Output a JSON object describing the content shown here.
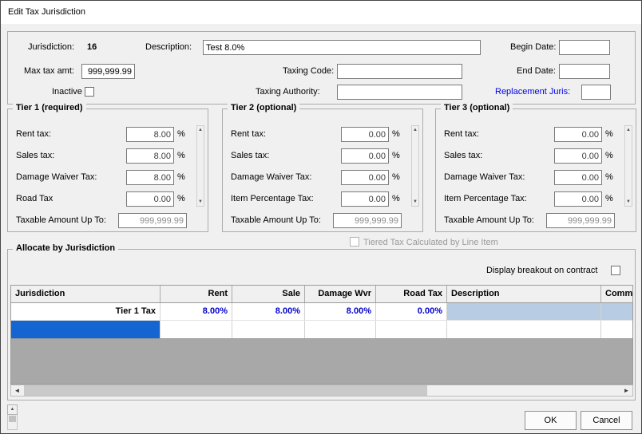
{
  "window": {
    "title": "Edit Tax Jurisdiction"
  },
  "header": {
    "jurisdiction_label": "Jurisdiction:",
    "jurisdiction_value": "16",
    "description_label": "Description:",
    "description_value": "Test 8.0%",
    "begin_date_label": "Begin Date:",
    "begin_date_value": "",
    "max_tax_label": "Max tax amt:",
    "max_tax_value": "999,999.99",
    "taxing_code_label": "Taxing Code:",
    "taxing_code_value": "",
    "end_date_label": "End Date:",
    "end_date_value": "",
    "inactive_label": "Inactive",
    "taxing_authority_label": "Taxing Authority:",
    "taxing_authority_value": "",
    "replacement_label": "Replacement Juris:",
    "replacement_value": ""
  },
  "tiers": [
    {
      "title": "Tier 1 (required)",
      "percent": "%",
      "rows": [
        {
          "label": "Rent tax:",
          "value": "8.00"
        },
        {
          "label": "Sales tax:",
          "value": "8.00"
        },
        {
          "label": "Damage Waiver Tax:",
          "value": "8.00"
        },
        {
          "label": "Road Tax",
          "value": "0.00"
        }
      ],
      "taxable_label": "Taxable Amount Up To:",
      "taxable_value": "999,999.99"
    },
    {
      "title": "Tier 2 (optional)",
      "percent": "%",
      "rows": [
        {
          "label": "Rent tax:",
          "value": "0.00"
        },
        {
          "label": "Sales tax:",
          "value": "0.00"
        },
        {
          "label": "Damage Waiver Tax:",
          "value": "0.00"
        },
        {
          "label": "Item Percentage Tax:",
          "value": "0.00"
        }
      ],
      "taxable_label": "Taxable Amount Up To:",
      "taxable_value": "999,999.99"
    },
    {
      "title": "Tier 3 (optional)",
      "percent": "%",
      "rows": [
        {
          "label": "Rent tax:",
          "value": "0.00"
        },
        {
          "label": "Sales tax:",
          "value": "0.00"
        },
        {
          "label": "Damage Waiver Tax:",
          "value": "0.00"
        },
        {
          "label": "Item Percentage Tax:",
          "value": "0.00"
        }
      ],
      "taxable_label": "Taxable Amount Up To:",
      "taxable_value": "999,999.99"
    }
  ],
  "tiered_line_item_label": "Tiered Tax Calculated by Line Item",
  "allocate": {
    "title": "Allocate by Jurisdiction",
    "breakout_label": "Display breakout on contract",
    "headers": [
      "Jurisdiction",
      "Rent",
      "Sale",
      "Damage Wvr",
      "Road Tax",
      "Description",
      "Comme"
    ],
    "row1": [
      "Tier 1 Tax",
      "8.00%",
      "8.00%",
      "8.00%",
      "0.00%",
      "",
      ""
    ]
  },
  "buttons": {
    "ok": "OK",
    "cancel": "Cancel"
  },
  "colors": {
    "link_blue": "#0000ee",
    "value_blue": "#0000cc",
    "selection_blue": "#1464d2",
    "row_highlight": "#b8cce4"
  }
}
